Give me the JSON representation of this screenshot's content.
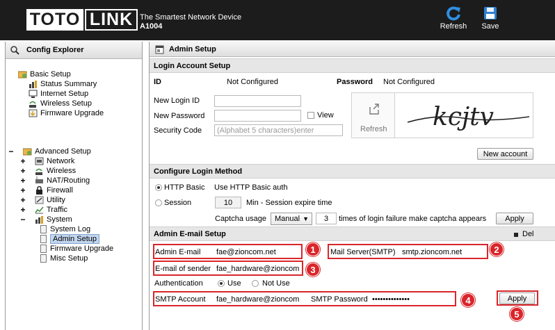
{
  "header": {
    "logo_left": "TOTO",
    "logo_right": "LINK",
    "tagline": "The Smartest Network Device",
    "model": "A1004",
    "refresh_label": "Refresh",
    "save_label": "Save"
  },
  "sidebar": {
    "title": "Config Explorer",
    "basic": {
      "label": "Basic Setup",
      "items": [
        "Status Summary",
        "Internet Setup",
        "Wireless Setup",
        "Firmware Upgrade"
      ]
    },
    "advanced": {
      "label": "Advanced Setup",
      "items": [
        "Network",
        "Wireless",
        "NAT/Routing",
        "Firewall",
        "Utility",
        "Traffic",
        "System"
      ],
      "system_items": [
        "System Log",
        "Admin Setup",
        "Firmware Upgrade",
        "Misc Setup"
      ],
      "selected": "Admin Setup"
    }
  },
  "main": {
    "title": "Admin Setup",
    "login_account": {
      "section": "Login Account Setup",
      "id_label": "ID",
      "id_value": "Not Configured",
      "password_label": "Password",
      "password_value": "Not Configured",
      "new_login_id_label": "New Login ID",
      "new_login_id_value": "",
      "new_password_label": "New Password",
      "new_password_value": "",
      "view_label": "View",
      "security_code_label": "Security Code",
      "security_code_placeholder": "(Alphabet 5 characters)enter",
      "refresh_label": "Refresh",
      "captcha_text": "kcjtv",
      "new_account_button": "New account"
    },
    "login_method": {
      "section": "Configure Login Method",
      "http_basic_label": "HTTP Basic",
      "http_basic_desc": "Use HTTP Basic auth",
      "session_label": "Session",
      "session_minutes": "10",
      "session_desc": "Min - Session expire time",
      "captcha_usage_label": "Captcha usage",
      "captcha_usage_value": "Manual",
      "captcha_failures": "3",
      "captcha_desc": "times of login failure make captcha appears",
      "apply_label": "Apply"
    },
    "email": {
      "section": "Admin E-mail Setup",
      "del_label": "Del",
      "admin_email_label": "Admin E-mail",
      "admin_email_value": "fae@zioncom.net",
      "mail_server_label": "Mail Server(SMTP)",
      "mail_server_value": "smtp.zioncom.net",
      "sender_label": "E-mail of sender",
      "sender_value": "fae_hardware@zioncom.r",
      "auth_label": "Authentication",
      "auth_use": "Use",
      "auth_not_use": "Not Use",
      "smtp_account_label": "SMTP Account",
      "smtp_account_value": "fae_hardware@zioncom.r",
      "smtp_password_label": "SMTP Password",
      "smtp_password_value": "••••••••••••••",
      "apply_label": "Apply"
    },
    "callouts": [
      "1",
      "2",
      "3",
      "4",
      "5"
    ]
  },
  "colors": {
    "header_bg": "#1c1c1c",
    "callout_red": "#d9252a",
    "section_bg": "#e6e6e6",
    "selection": "#c3d6ef"
  }
}
